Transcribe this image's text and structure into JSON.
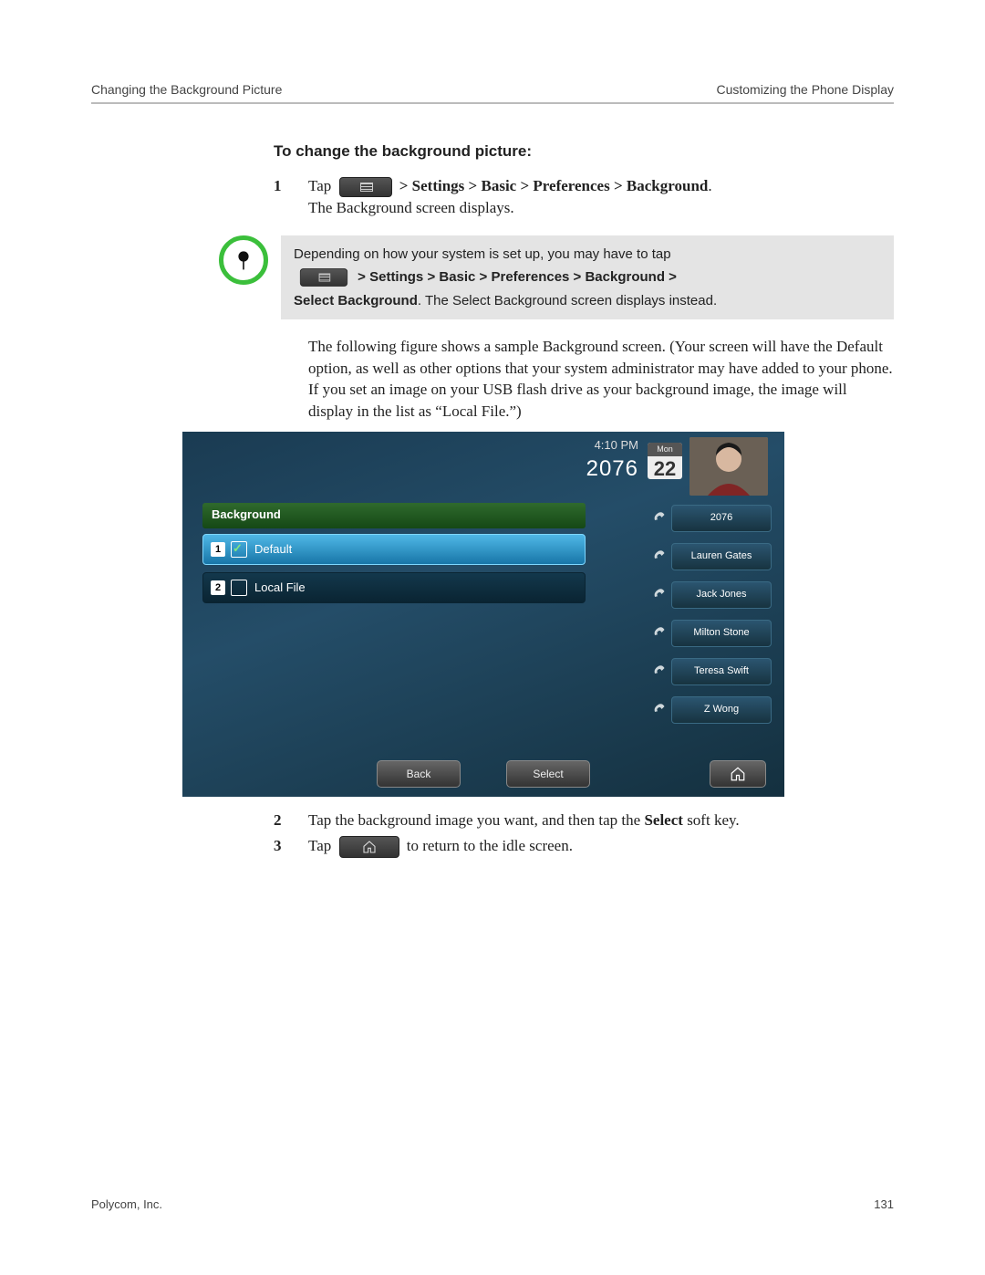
{
  "header": {
    "left": "Changing the Background Picture",
    "right": "Customizing the Phone Display"
  },
  "section": {
    "title": "To change the background picture:"
  },
  "steps": {
    "s1": {
      "num": "1",
      "tap": "Tap",
      "path": "> Settings > Basic > Preferences > Background",
      "period": ".",
      "result": "The Background screen displays."
    },
    "s2": {
      "num": "2",
      "pre": "Tap the background image you want, and then tap the ",
      "bold": "Select",
      "post": " soft key."
    },
    "s3": {
      "num": "3",
      "tap": "Tap",
      "post": "to return to the idle screen."
    }
  },
  "note": {
    "line1": "Depending on how your system is set up, you may have to tap",
    "path": "> Settings > Basic > Preferences > Background >",
    "bold2": "Select Background",
    "rest": ". The Select Background screen displays instead."
  },
  "para1": "The following figure shows a sample Background screen. (Your screen will have the Default option, as well as other options that your system administrator may have added to your phone. If you set an image on your USB flash drive as your background image, the image will display in the list as “Local File.”)",
  "phone": {
    "time": "4:10 PM",
    "extension": "2076",
    "dow": "Mon",
    "date": "22",
    "title": "Background",
    "items": [
      {
        "idx": "1",
        "label": "Default",
        "checked": true,
        "selected": true
      },
      {
        "idx": "2",
        "label": "Local File",
        "checked": false,
        "selected": false
      }
    ],
    "contacts": [
      "2076",
      "Lauren Gates",
      "Jack Jones",
      "Milton Stone",
      "Teresa Swift",
      "Z Wong"
    ],
    "softkeys": {
      "back": "Back",
      "select": "Select"
    }
  },
  "footer": {
    "left": "Polycom, Inc.",
    "right": "131"
  }
}
